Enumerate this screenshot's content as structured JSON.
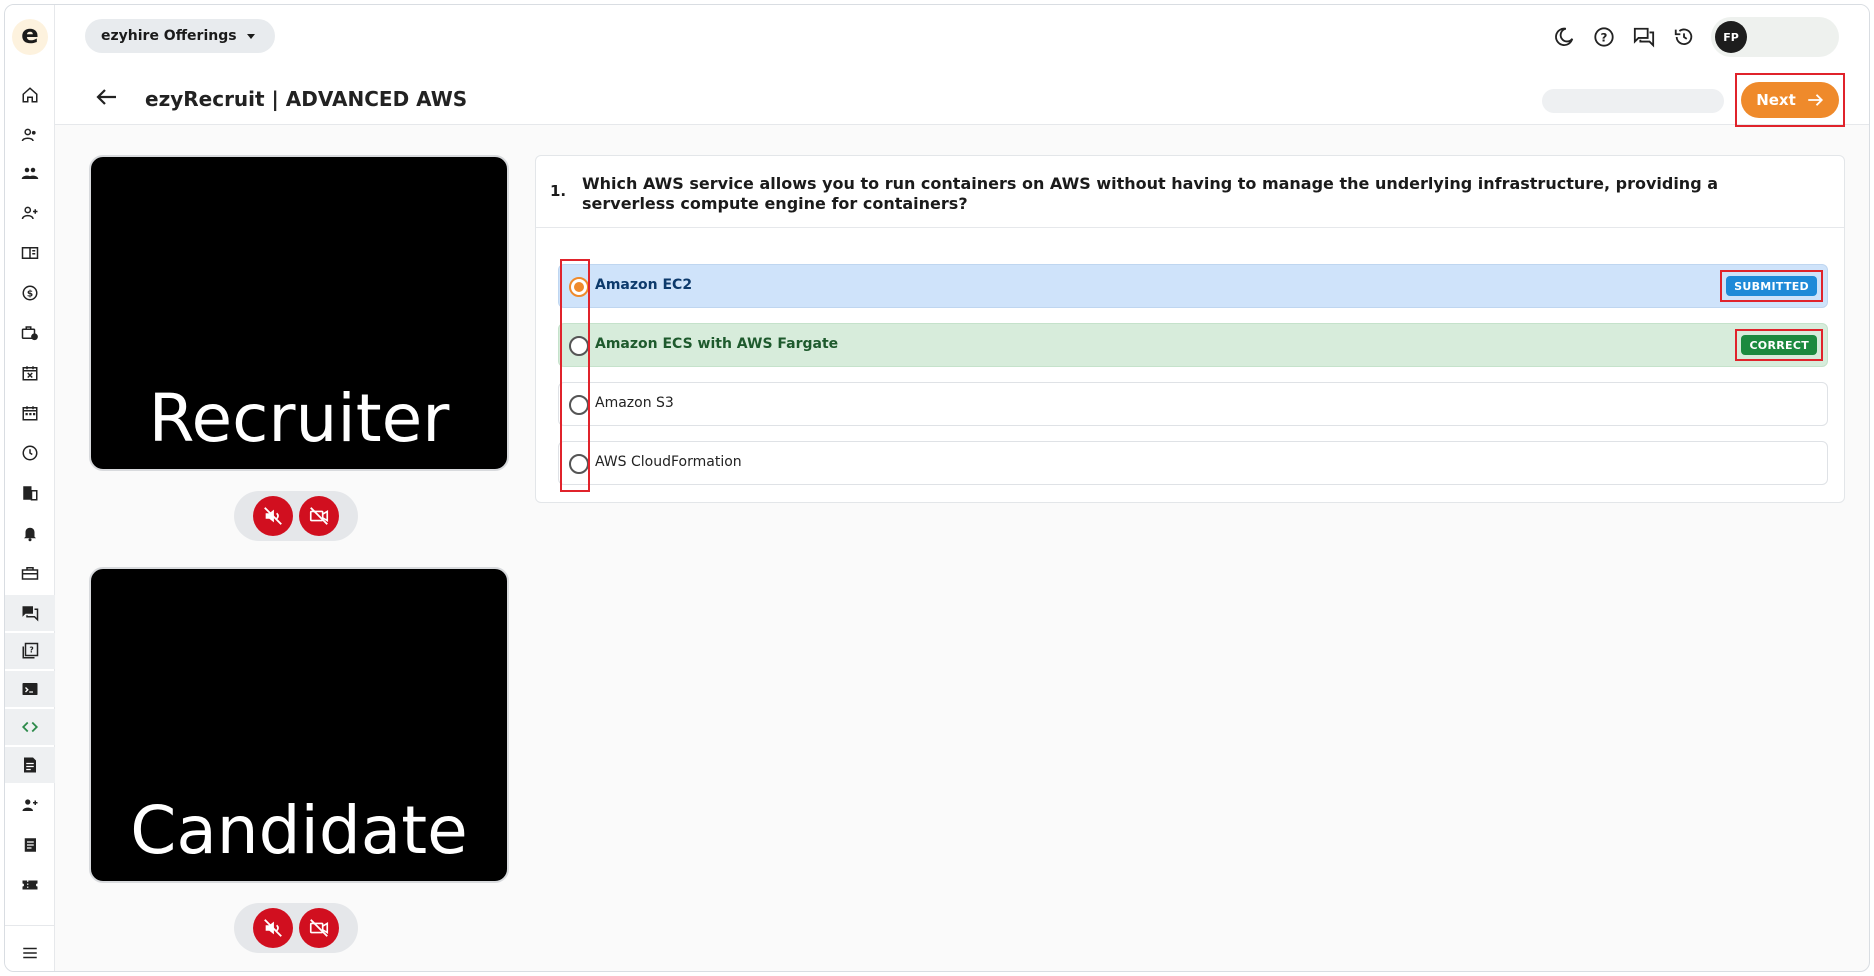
{
  "header": {
    "offerings_label": "ezyhire Offerings",
    "page_title": "ezyRecruit | ADVANCED AWS",
    "avatar_initials": "FP",
    "next_label": "Next"
  },
  "logo": {
    "letter": "e"
  },
  "sidebar": {
    "items": [
      {
        "icon": "home-icon"
      },
      {
        "icon": "users-icon"
      },
      {
        "icon": "team-icon"
      },
      {
        "icon": "add-user-icon"
      },
      {
        "icon": "book-icon"
      },
      {
        "icon": "dollar-icon"
      },
      {
        "icon": "briefcase-clock-icon"
      },
      {
        "icon": "calendar-x-icon"
      },
      {
        "icon": "calendar-icon"
      },
      {
        "icon": "clock-icon"
      },
      {
        "icon": "building-icon"
      },
      {
        "icon": "bell-icon"
      },
      {
        "icon": "toolbox-icon"
      },
      {
        "icon": "chat-icon"
      },
      {
        "icon": "quiz-book-icon"
      },
      {
        "icon": "terminal-icon"
      },
      {
        "icon": "code-icon"
      },
      {
        "icon": "document-icon"
      },
      {
        "icon": "user-plus-icon"
      },
      {
        "icon": "receipt-icon"
      },
      {
        "icon": "ticket-icon"
      },
      {
        "icon": "menu-icon"
      }
    ]
  },
  "videos": {
    "recruiter_label": "Recruiter",
    "candidate_label": "Candidate"
  },
  "question": {
    "number": "1.",
    "text": "Which AWS service allows you to run containers on AWS without having to manage the underlying infrastructure, providing a serverless compute engine for containers?",
    "options": [
      {
        "label": "Amazon EC2",
        "state": "submitted",
        "badge": "SUBMITTED"
      },
      {
        "label": "Amazon ECS with AWS Fargate",
        "state": "correct",
        "badge": "CORRECT"
      },
      {
        "label": "Amazon S3",
        "state": "none"
      },
      {
        "label": "AWS CloudFormation",
        "state": "none"
      }
    ]
  },
  "colors": {
    "accent": "#ef8a2b",
    "submitted_bg": "#cfe3fa",
    "correct_bg": "#d7ecdb",
    "highlight_red": "#e0232b",
    "mute_red": "#d10f1f"
  }
}
